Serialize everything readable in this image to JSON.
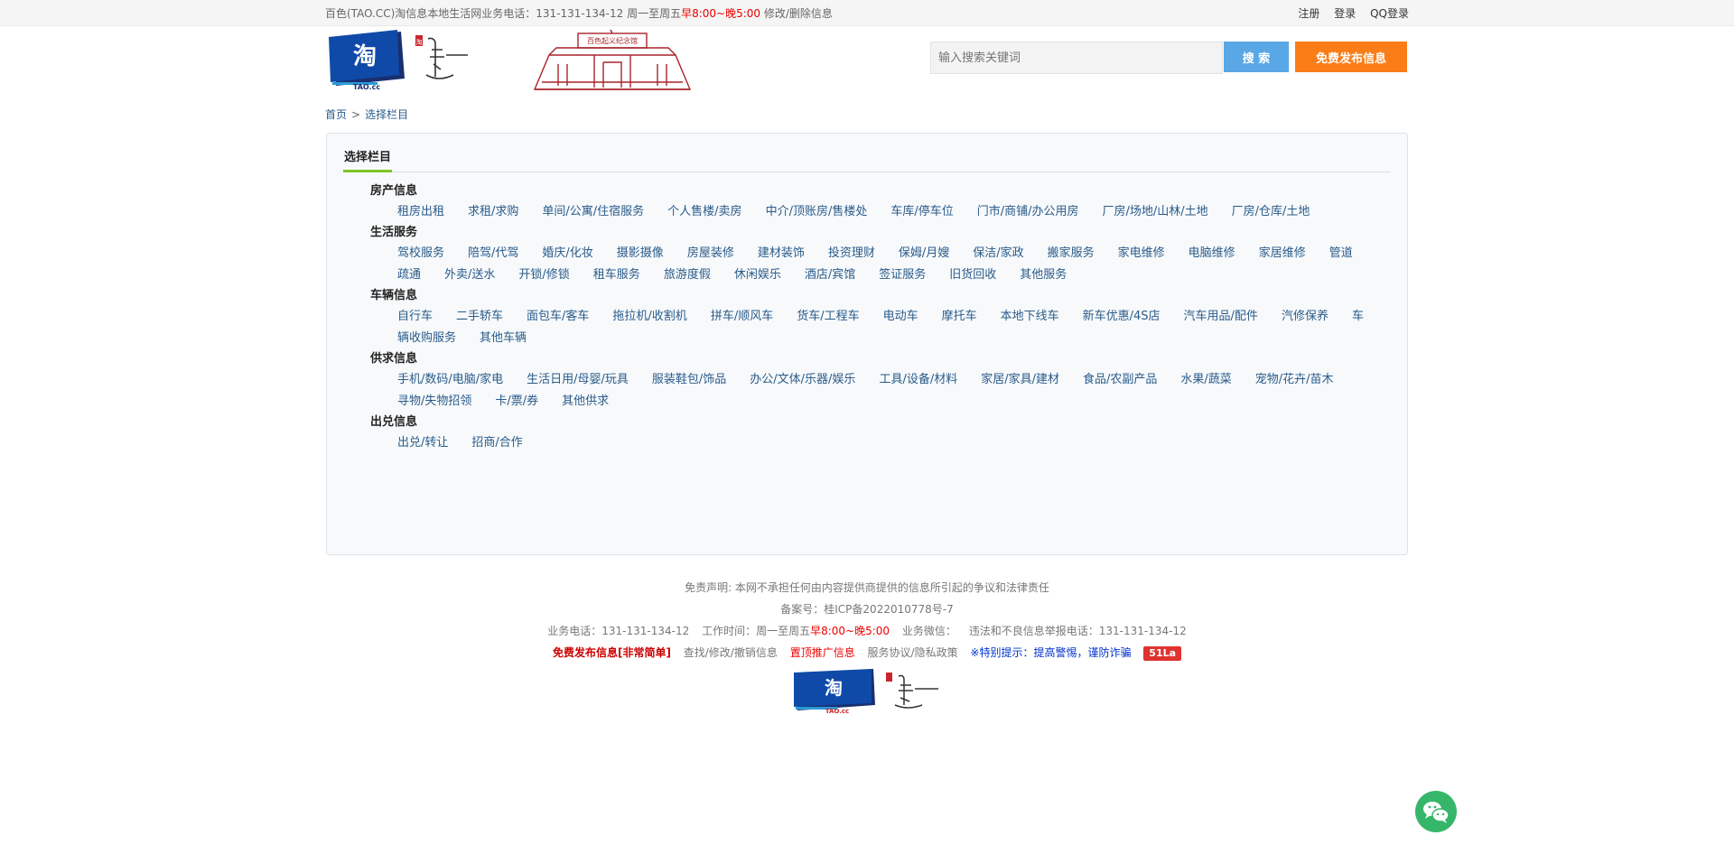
{
  "topbar": {
    "info_text": "百色(TAO.CC)淘信息本地生活网业务电话：131-131-134-12 周一至周五",
    "hours_text": "早8:00~晚5:00",
    "edit_link": " 修改/删除信息",
    "links": [
      "注册",
      "登录",
      "QQ登录"
    ]
  },
  "header": {
    "logo_text": "淘",
    "logo_sub": "TAO.cc",
    "logo_stamp": "淘",
    "seal_label": "百色起义纪念馆"
  },
  "search": {
    "placeholder": "输入搜索关键词",
    "button_label": "搜 索",
    "post_label": "免费发布信息"
  },
  "breadcrumb": {
    "home": "首页",
    "sep": ">",
    "current": "选择栏目"
  },
  "panel": {
    "title": "选择栏目",
    "categories": [
      {
        "title": "房产信息",
        "items": [
          "租房出租",
          "求租/求购",
          "单间/公寓/住宿服务",
          "个人售楼/卖房",
          "中介/顶账房/售楼处",
          "车库/停车位",
          "门市/商铺/办公用房",
          "厂房/场地/山林/土地",
          "厂房/仓库/土地"
        ]
      },
      {
        "title": "生活服务",
        "items": [
          "驾校服务",
          "陪驾/代驾",
          "婚庆/化妆",
          "摄影摄像",
          "房屋装修",
          "建材装饰",
          "投资理财",
          "保姆/月嫂",
          "保洁/家政",
          "搬家服务",
          "家电维修",
          "电脑维修",
          "家居维修",
          "管道疏通",
          "外卖/送水",
          "开锁/修锁",
          "租车服务",
          "旅游度假",
          "休闲娱乐",
          "酒店/宾馆",
          "签证服务",
          "旧货回收",
          "其他服务"
        ]
      },
      {
        "title": "车辆信息",
        "items": [
          "自行车",
          "二手轿车",
          "面包车/客车",
          "拖拉机/收割机",
          "拼车/顺风车",
          "货车/工程车",
          "电动车",
          "摩托车",
          "本地下线车",
          "新车优惠/4S店",
          "汽车用品/配件",
          "汽修保养",
          "车辆收购服务",
          "其他车辆"
        ]
      },
      {
        "title": "供求信息",
        "items": [
          "手机/数码/电脑/家电",
          "生活日用/母婴/玩具",
          "服装鞋包/饰品",
          "办公/文体/乐器/娱乐",
          "工具/设备/材料",
          "家居/家具/建材",
          "食品/农副产品",
          "水果/蔬菜",
          "宠物/花卉/苗木",
          "寻物/失物招领",
          "卡/票/券",
          "其他供求"
        ]
      },
      {
        "title": "出兑信息",
        "items": [
          "出兑/转让",
          "招商/合作"
        ]
      }
    ]
  },
  "footer": {
    "disclaimer": "免责声明: 本网不承担任何由内容提供商提供的信息所引起的争议和法律责任",
    "icp": "备案号：桂ICP备2022010778号-7",
    "phone": "业务电话：131-131-134-12",
    "worktime_prefix": "工作时间：周一至周五",
    "worktime_hours": "早8:00~晚5:00",
    "wechat": "业务微信：",
    "report": "违法和不良信息举报电话：131-131-134-12",
    "link_free_post": "免费发布信息[非常简单]",
    "link_manage": "查找/修改/撤销信息",
    "link_top": "置顶推广信息",
    "link_terms": "服务协议/隐私政策",
    "warning": "※特别提示：提高警惕，谨防诈骗",
    "badge": "51La"
  },
  "colors": {
    "link": "#2a5b8a",
    "search_button": "#5aa7e6",
    "post_button": "#fb7d17",
    "title_underline": "#7cc623",
    "wechat": "#36b66a"
  }
}
